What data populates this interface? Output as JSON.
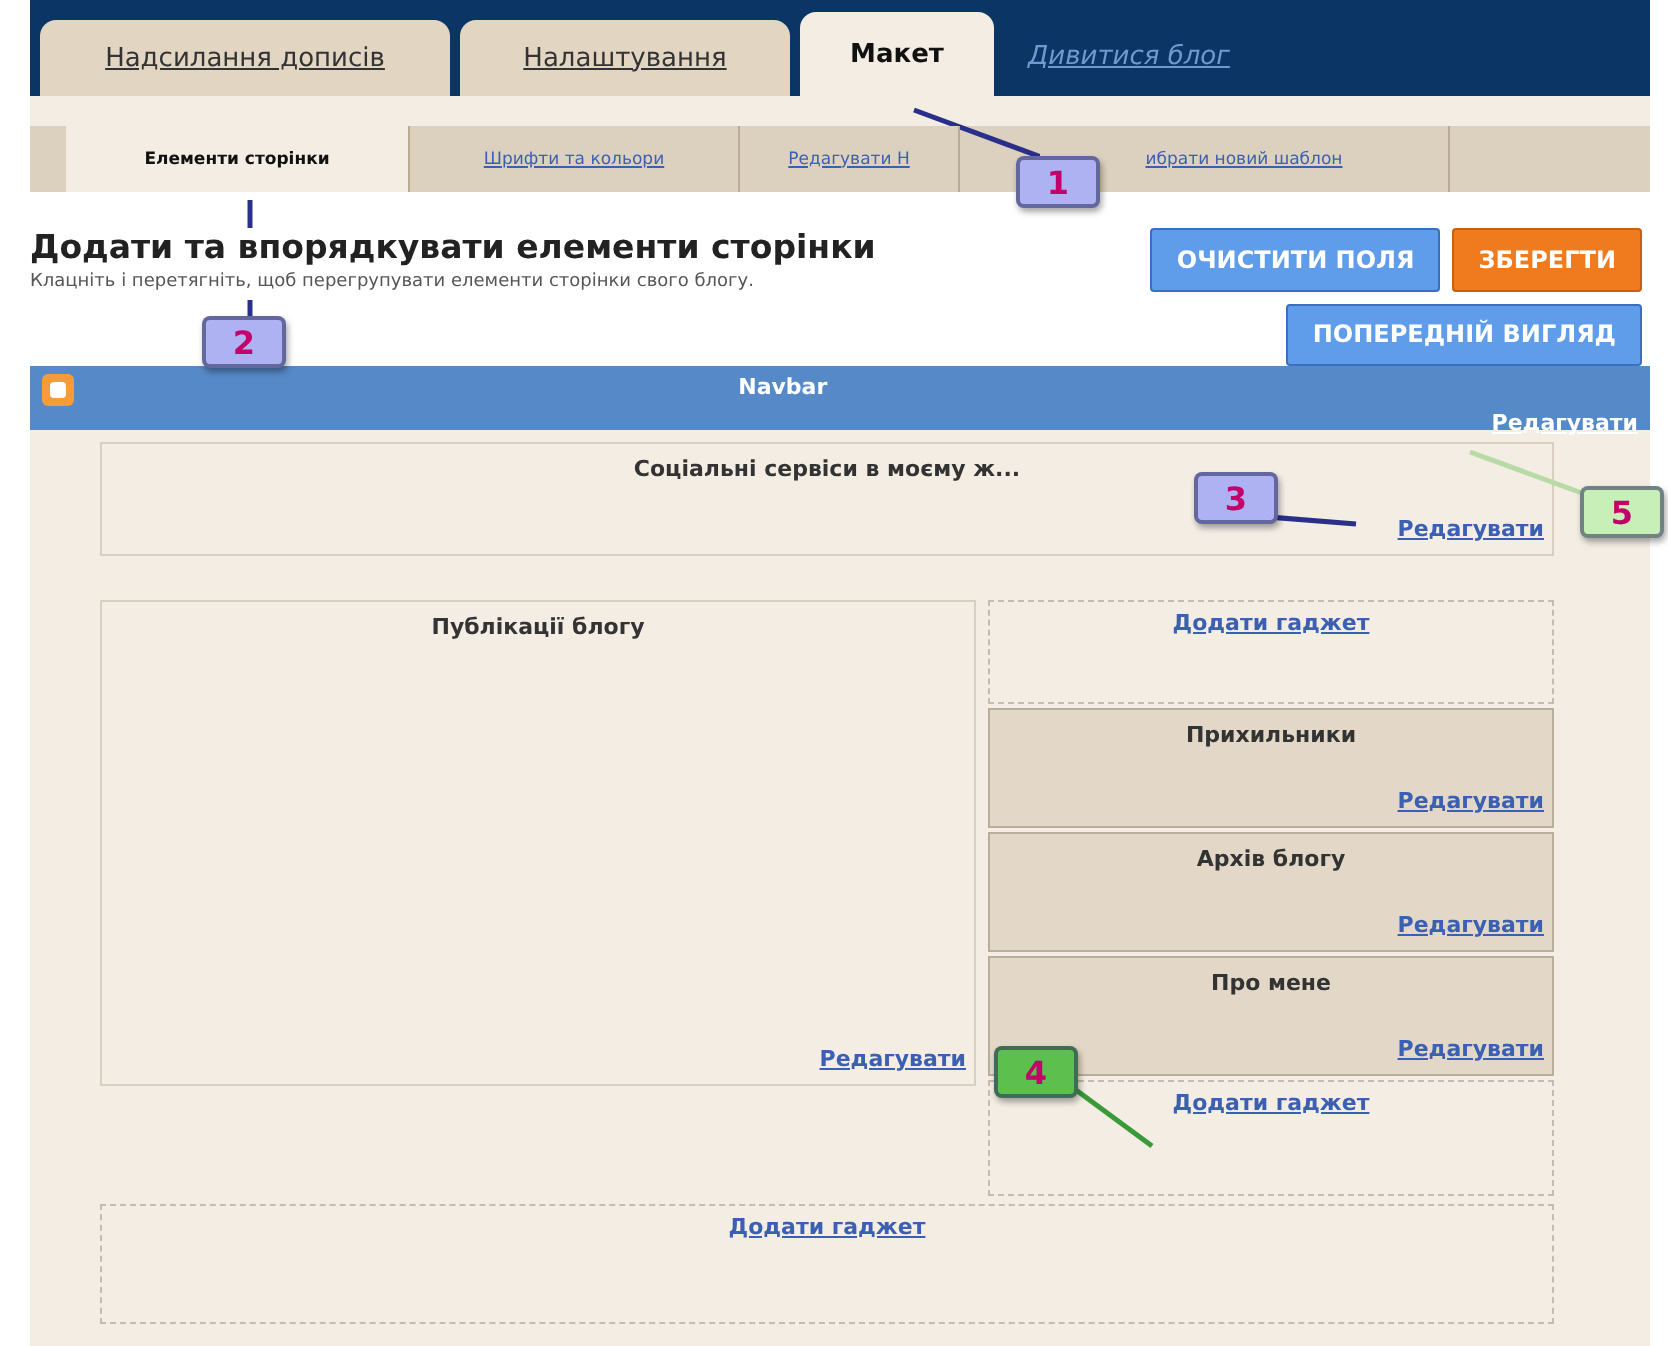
{
  "main_tabs": [
    {
      "label": "Надсилання дописів",
      "kind": "tab",
      "selected": false
    },
    {
      "label": "Налаштування",
      "kind": "tab",
      "selected": false
    },
    {
      "label": "Макет",
      "kind": "tab",
      "selected": true
    },
    {
      "label": "Дивитися блог",
      "kind": "link",
      "selected": false
    }
  ],
  "sub_tabs": [
    {
      "label": "Елементи сторінки",
      "selected": true
    },
    {
      "label": "Шрифти та кольори",
      "selected": false
    },
    {
      "label": "Редагувати Н",
      "selected": false
    },
    {
      "label": "ибрати новий шаблон",
      "selected": false
    }
  ],
  "heading": "Додати та впорядкувати елементи сторінки",
  "description": "Клацніть і перетягніть, щоб перегрупувати елементи сторінки свого блогу.",
  "buttons": [
    {
      "label": "ОЧИСТИТИ ПОЛЯ",
      "kind": "blue"
    },
    {
      "label": "ЗБЕРЕГТИ",
      "kind": "orange"
    },
    {
      "label": "ПОПЕРЕДНІЙ ВИГЛЯД",
      "kind": "blue"
    }
  ],
  "navbar": {
    "title": "Navbar",
    "edit_link": "Редагувати"
  },
  "header_gadget": {
    "title": "Соціальні сервіси в моєму ж...",
    "edit_link": "Редагувати"
  },
  "main_column": {
    "title": "Публікації блогу",
    "edit_link": "Редагувати"
  },
  "sidebar": {
    "add_gadget_top": "Додати гаджет",
    "gadgets": [
      {
        "title": "Прихильники",
        "edit_link": "Редагувати"
      },
      {
        "title": "Архів блогу",
        "edit_link": "Редагувати"
      },
      {
        "title": "Про мене",
        "edit_link": "Редагувати"
      }
    ],
    "add_gadget_bottom": "Додати гаджет"
  },
  "footer": {
    "add_gadget": "Додати гаджет"
  },
  "callouts": [
    {
      "label": "1",
      "color": "#aeb1f2"
    },
    {
      "label": "2",
      "color": "#aeb1f2"
    },
    {
      "label": "3",
      "color": "#aeb1f2"
    },
    {
      "label": "4",
      "color": "#5cbf4e"
    },
    {
      "label": "5",
      "color": "#c8efb8"
    }
  ]
}
